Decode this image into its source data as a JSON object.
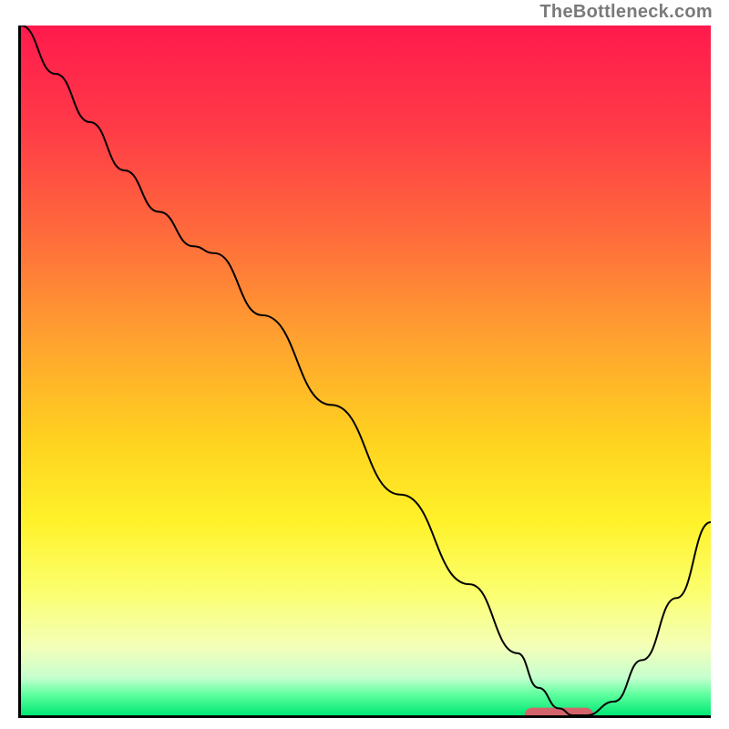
{
  "attribution": "TheBottleneck.com",
  "chart_data": {
    "type": "line",
    "title": "",
    "xlabel": "",
    "ylabel": "",
    "xlim": [
      0,
      100
    ],
    "ylim": [
      0,
      100
    ],
    "grid": false,
    "legend": false,
    "annotations": [],
    "background_gradient_stops": [
      {
        "offset": 0.0,
        "color": "#ff1a4d"
      },
      {
        "offset": 0.15,
        "color": "#ff3b47"
      },
      {
        "offset": 0.3,
        "color": "#ff6a3c"
      },
      {
        "offset": 0.45,
        "color": "#ffa030"
      },
      {
        "offset": 0.6,
        "color": "#ffd21f"
      },
      {
        "offset": 0.72,
        "color": "#fff22a"
      },
      {
        "offset": 0.82,
        "color": "#fbff6e"
      },
      {
        "offset": 0.9,
        "color": "#f4ffb8"
      },
      {
        "offset": 0.945,
        "color": "#c7ffcf"
      },
      {
        "offset": 0.97,
        "color": "#5eff9e"
      },
      {
        "offset": 1.0,
        "color": "#00e873"
      }
    ],
    "series": [
      {
        "name": "bottleneck-curve",
        "stroke": "#000000",
        "stroke_width": 2,
        "x": [
          0,
          5,
          10,
          15,
          20,
          25,
          28,
          35,
          45,
          55,
          65,
          72,
          75,
          78,
          80,
          82,
          86,
          90,
          95,
          100
        ],
        "y": [
          100,
          93,
          86,
          79,
          73,
          68,
          67,
          58,
          45,
          32,
          19,
          9,
          4,
          1,
          0,
          0,
          2,
          8,
          17,
          28
        ]
      }
    ],
    "markers": [
      {
        "name": "optimal-band",
        "shape": "rounded-rect",
        "fill": "#d4646b",
        "x_center": 78,
        "y_center": 0,
        "width": 10,
        "height": 2.2,
        "rx": 1.1
      }
    ]
  }
}
